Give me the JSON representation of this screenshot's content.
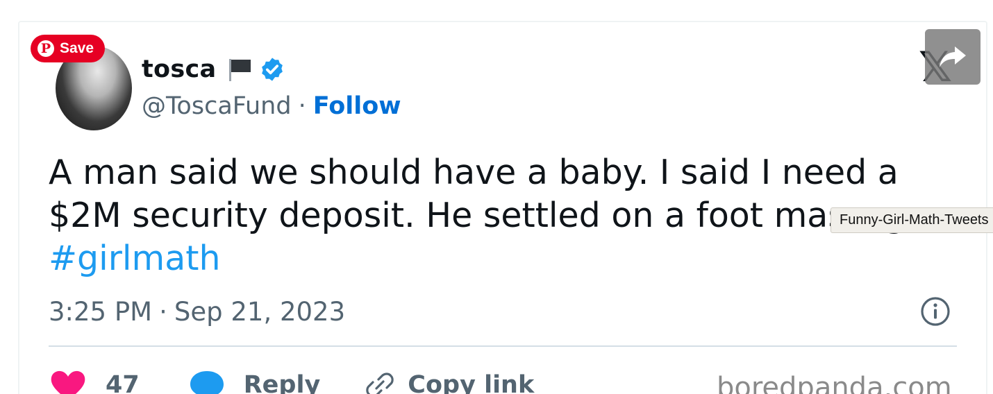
{
  "pinterest": {
    "save_label": "Save",
    "icon": "pinterest-logo-icon"
  },
  "author": {
    "name": "tosca",
    "handle": "@ToscaFund",
    "separator": "·",
    "follow_label": "Follow"
  },
  "tweet": {
    "text": "A man said we should have a baby. I said I need a $2M security deposit. He settled on a foot massage.",
    "hashtag": "#girlmath",
    "time": "3:25 PM",
    "separator": "·",
    "date": "Sep 21, 2023"
  },
  "platform_logo": "𝕏",
  "tooltip": "Funny-Girl-Math-Tweets",
  "actions": {
    "like_count": "47",
    "reply_label": "Reply",
    "copy_link_label": "Copy link"
  },
  "watermark": "boredpanda.com",
  "colors": {
    "pinterest_red": "#e60023",
    "follow_blue": "#006fd6",
    "hashtag_blue": "#1d9bf0",
    "verified_blue": "#1d9bf0",
    "like_pink": "#f91880",
    "reply_blue": "#1d9bf0",
    "secondary_text": "#536471"
  }
}
